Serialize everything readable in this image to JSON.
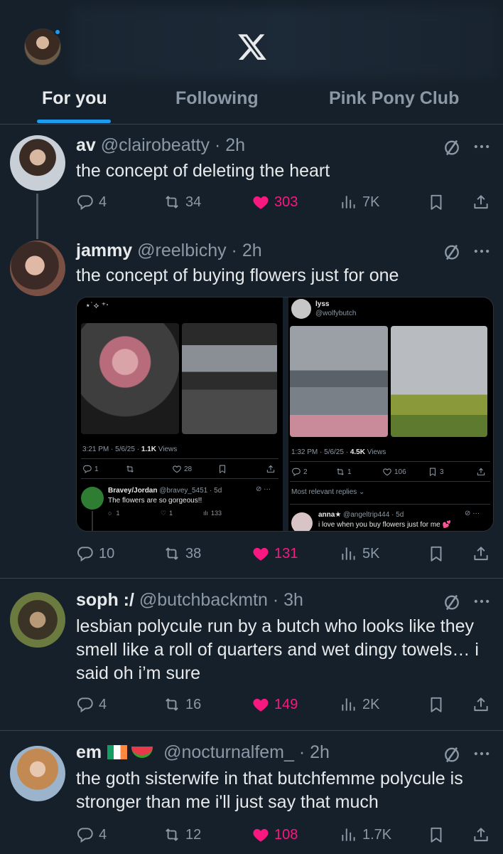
{
  "header": {
    "tabs": [
      "For you",
      "Following",
      "Pink Pony Club"
    ]
  },
  "colors": {
    "accent": "#1d9bf0",
    "like": "#f91880",
    "background": "#15202b"
  },
  "posts": [
    {
      "name": "av",
      "handle": "@clairobeatty",
      "time": "2h",
      "text": "the concept of deleting the heart",
      "replies": "4",
      "reposts": "34",
      "likes": "303",
      "views": "7K"
    },
    {
      "name": "jammy",
      "handle": "@reelbichy",
      "time": "2h",
      "text": "the concept of buying flowers just for one",
      "replies": "10",
      "reposts": "38",
      "likes": "131",
      "views": "5K",
      "media": {
        "left": {
          "meta": "3:21 PM · 5/6/25 · ",
          "views_count": "1.1K",
          "views_label": " Views",
          "replies": "1",
          "likes": "28",
          "reply_name": "Bravey/Jordan",
          "reply_handle": "@bravey_5451 · 5d",
          "reply_text": "The flowers are so gorgeous!!",
          "reply_replies": "1",
          "reply_likes": "1",
          "reply_views": "133"
        },
        "right": {
          "name": "lyss",
          "handle": "@wolfybutch",
          "meta": "1:32 PM · 5/6/25 · ",
          "views_count": "4.5K",
          "views_label": " Views",
          "replies": "2",
          "reposts": "1",
          "likes": "106",
          "bookmarks": "3",
          "sort_label": "Most relevant replies",
          "reply_name": "anna★",
          "reply_handle": "@angeltrip444 · 5d",
          "reply_text": "i love when you buy flowers just for me"
        }
      }
    },
    {
      "name": "soph :/",
      "handle": "@butchbackmtn",
      "time": "3h",
      "text": "lesbian polycule run by a butch who looks like they smell like a roll of quarters and wet dingy towels… i said oh i’m sure",
      "replies": "4",
      "reposts": "16",
      "likes": "149",
      "views": "2K"
    },
    {
      "name": "em",
      "handle": "@nocturnalfem_",
      "time": "2h",
      "text": "the goth sisterwife in that butchfemme polycule is stronger than me i'll just say that much",
      "replies": "4",
      "reposts": "12",
      "likes": "108",
      "views": "1.7K"
    }
  ]
}
